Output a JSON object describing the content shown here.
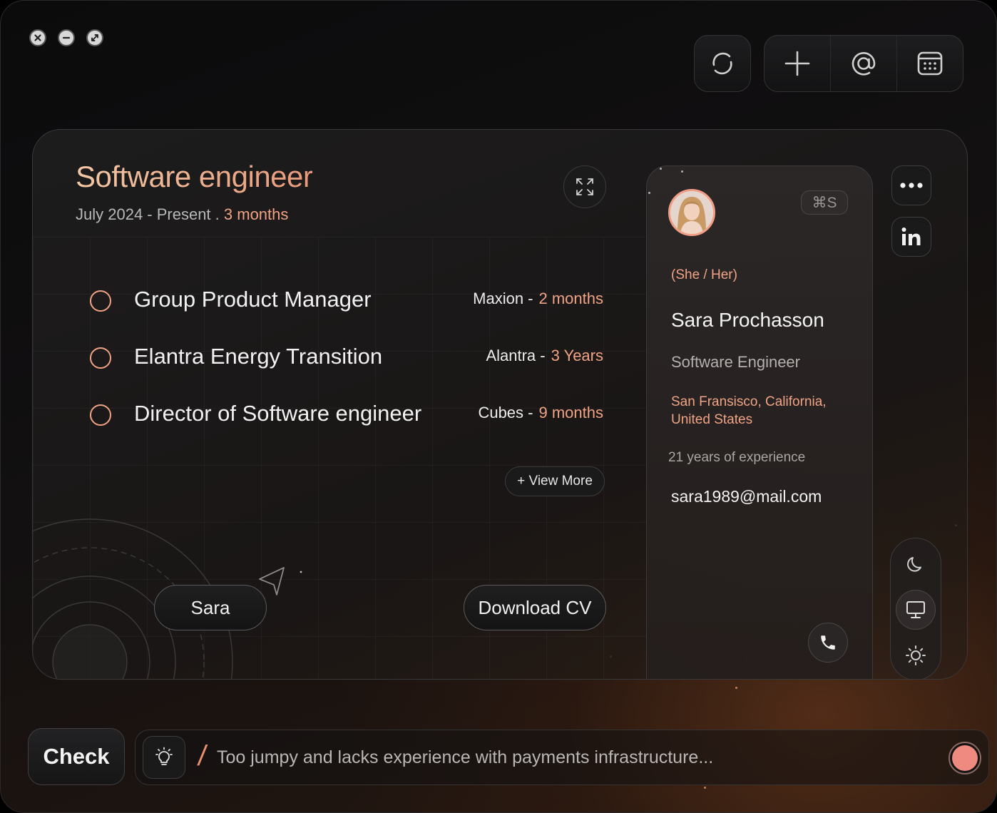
{
  "window": {
    "controls": [
      "close",
      "minimize",
      "fullscreen"
    ]
  },
  "toolbar": {
    "icons": [
      "refresh-icon",
      "plus-icon",
      "at-icon",
      "calendar-icon"
    ]
  },
  "job": {
    "title": "Software engineer",
    "dates": "July 2024 - Present . ",
    "duration": "3 months",
    "experience": [
      {
        "name": "Group Product Manager",
        "company": "Maxion -",
        "duration": "2 months"
      },
      {
        "name": "Elantra Energy Transition",
        "company": "Alantra -",
        "duration": "3 Years"
      },
      {
        "name": "Director of Software engineer",
        "company": "Cubes -",
        "duration": "9 months"
      }
    ],
    "view_more": "+ View More",
    "sara_label": "Sara",
    "download_label": "Download CV"
  },
  "profile": {
    "shortcut": "⌘S",
    "pronouns": "(She / Her)",
    "name": "Sara Prochasson",
    "role": "Software Engineer",
    "location": "San Fransisco, California, United States",
    "experience_years": "21 years of experience",
    "email": "sara1989@mail.com"
  },
  "bottom": {
    "check_label": "Check",
    "input_value": "Too jumpy and lacks experience with payments infrastructure..."
  },
  "colors": {
    "accent": "#f0a384",
    "record": "#ef8a80"
  }
}
